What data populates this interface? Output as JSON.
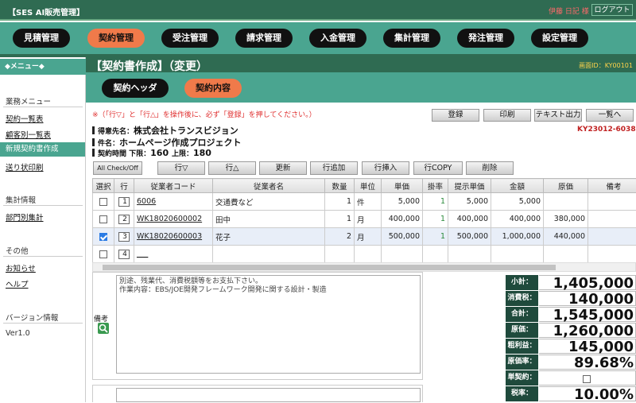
{
  "app": {
    "title": "【SES AI販売管理】",
    "user": "伊藤 日記 様",
    "logout": "ログアウト"
  },
  "nav": [
    "見積管理",
    "契約管理",
    "受注管理",
    "請求管理",
    "入金管理",
    "集計管理",
    "発注管理",
    "設定管理"
  ],
  "sidebar": {
    "menu_header": "◆メニュー◆",
    "section_business": "業務メニュー",
    "business_items": [
      "契約一覧表",
      "顧客別一覧表",
      "新規契約書作成",
      "送り状印刷"
    ],
    "section_stats": "集計情報",
    "stats_items": [
      "部門別集計"
    ],
    "section_other": "その他",
    "other_items": [
      "お知らせ",
      "ヘルプ"
    ],
    "section_version": "バージョン情報",
    "version": "Ver1.0"
  },
  "page": {
    "title": "【契約書作成】（変更）",
    "screen_id": "画面ID：KY00101"
  },
  "tabs": {
    "header": "契約ヘッダ",
    "content": "契約内容"
  },
  "notice": "※（「行▽」と「行△」を操作後に、必ず「登録」を押してください。）",
  "actions": {
    "register": "登録",
    "print": "印刷",
    "text_export": "テキスト出力",
    "list": "一覧へ"
  },
  "contract": {
    "client_label": "得意先名：",
    "client": "株式会社トランスビジョン",
    "project_label": "件名：",
    "project": "ホームページ作成プロジェクト",
    "hours_label": "契約時間 下限：",
    "hours_min": "160",
    "hours_max_label": "上限：",
    "hours_max": "180",
    "doc_no": "KY23012-6038"
  },
  "toolbar": {
    "check_all": "All Check/Off",
    "row_down": "行▽",
    "row_up": "行△",
    "update": "更新",
    "add_row": "行追加",
    "insert_row": "行挿入",
    "copy_row": "行COPY",
    "delete": "削除"
  },
  "table": {
    "headers": [
      "選択",
      "行",
      "従業者コード",
      "従業者名",
      "数量",
      "単位",
      "単価",
      "掛率",
      "提示単価",
      "金額",
      "原価",
      "備考"
    ],
    "rows": [
      {
        "checked": false,
        "no": "1",
        "code": "6006",
        "name": "交通費など",
        "qty": "1",
        "unit": "件",
        "price": "5,000",
        "rate": "1",
        "offer": "5,000",
        "amount": "5,000",
        "cost": "",
        "note": ""
      },
      {
        "checked": false,
        "no": "2",
        "code": "WK18020600002",
        "name": "田中",
        "qty": "1",
        "unit": "月",
        "price": "400,000",
        "rate": "1",
        "offer": "400,000",
        "amount": "400,000",
        "cost": "380,000",
        "note": ""
      },
      {
        "checked": true,
        "no": "3",
        "code": "WK18020600003",
        "name": "花子",
        "qty": "2",
        "unit": "月",
        "price": "500,000",
        "rate": "1",
        "offer": "500,000",
        "amount": "1,000,000",
        "cost": "440,000",
        "note": ""
      },
      {
        "checked": false,
        "no": "4",
        "code": "___",
        "name": "",
        "qty": "",
        "unit": "",
        "price": "",
        "rate": "",
        "offer": "",
        "amount": "",
        "cost": "",
        "note": ""
      }
    ]
  },
  "notes": {
    "label": "備考",
    "text": "別途、残業代、消費税額等をお支払下さい。\n作業内容：EBS/JOE開発フレームワーク開発に関する設計・製造"
  },
  "totals": {
    "subtotal_label": "小計：",
    "subtotal": "1,405,000",
    "tax_label": "消費税：",
    "tax": "140,000",
    "total_label": "合計：",
    "total": "1,545,000",
    "cost_label": "原価：",
    "cost": "1,260,000",
    "gross_label": "粗利益：",
    "gross": "145,000",
    "cost_rate_label": "原価率：",
    "cost_rate": "89.68%",
    "single_label": "単契約：",
    "tax_rate_label": "税率：",
    "tax_rate": "10.00%"
  }
}
